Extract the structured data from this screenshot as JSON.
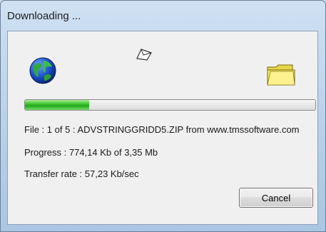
{
  "window": {
    "title": "Downloading ..."
  },
  "icons": {
    "source": "globe-icon",
    "transfer": "paper-icon",
    "destination": "folder-icon"
  },
  "progress": {
    "fraction": 0.22,
    "fill_color": "#3ec42e"
  },
  "info": {
    "file_line": "File : 1 of 5 : ADVSTRINGGRIDD5.ZIP from www.tmssoftware.com",
    "progress_line": "Progress : 774,14 Kb of 3,35 Mb",
    "rate_line": "Transfer rate : 57,23 Kb/sec"
  },
  "buttons": {
    "cancel": "Cancel"
  }
}
